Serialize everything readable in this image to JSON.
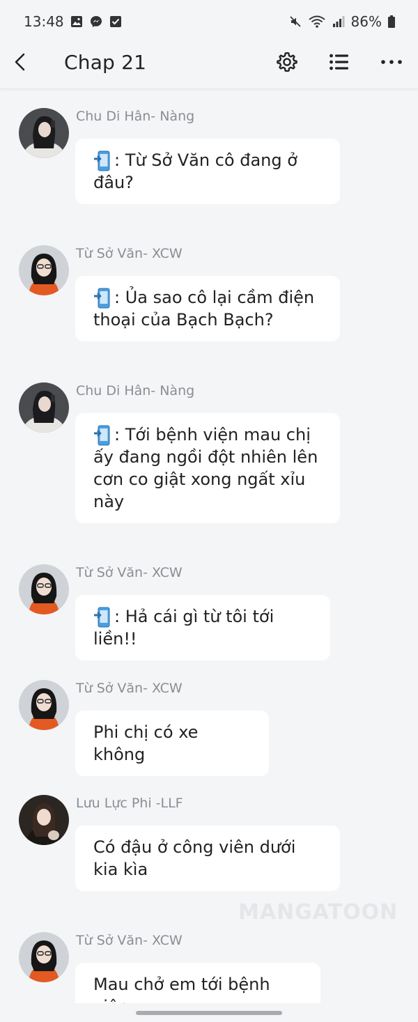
{
  "status_bar": {
    "time": "13:48",
    "battery": "86%",
    "left_icons": [
      "gallery-icon",
      "messenger-icon",
      "checkbox-icon"
    ],
    "right_icons": [
      "mute-icon",
      "wifi-icon",
      "signal-icon",
      "battery-icon"
    ]
  },
  "header": {
    "title": "Chap 21",
    "icons": [
      "back-arrow-icon",
      "gear-icon",
      "list-icon",
      "more-dots-icon"
    ]
  },
  "messages": [
    {
      "sender": "Chu Di Hân- Nàng",
      "text": ": Từ Sở Văn cô đang ở đâu?",
      "has_phone_icon": true,
      "avatar": "avatar-girl-white-top"
    },
    {
      "sender": "Từ Sở Văn- XCW",
      "text": ": Ủa sao cô lại cầm điện thoại của Bạch Bạch?",
      "has_phone_icon": true,
      "avatar": "avatar-girl-glasses"
    },
    {
      "sender": "Chu Di Hân- Nàng",
      "text": ": Tới bệnh viện mau chị ấy đang ngồi đột nhiên lên cơn co giật xong ngất xỉu này",
      "has_phone_icon": true,
      "avatar": "avatar-girl-white-top"
    },
    {
      "sender": "Từ Sở Văn- XCW",
      "text": ": Hả cái gì từ tôi tới liền!!",
      "has_phone_icon": true,
      "avatar": "avatar-girl-glasses"
    },
    {
      "sender": "Từ Sở Văn- XCW",
      "text": "Phi chị có xe không",
      "has_phone_icon": false,
      "avatar": "avatar-girl-glasses"
    },
    {
      "sender": "Lưu Lực Phi -LLF",
      "text": "Có đậu ở công viên dưới kia kìa",
      "has_phone_icon": false,
      "avatar": "avatar-girl-dark"
    },
    {
      "sender": "Từ Sở Văn- XCW",
      "text": "Mau chở em tới bệnh viện",
      "has_phone_icon": false,
      "avatar": "avatar-girl-glasses"
    }
  ],
  "watermark": "MANGATOON",
  "colors": {
    "background": "#f4f5f7",
    "bubble": "#ffffff",
    "sender_text": "#8a8d93",
    "message_text": "#222222",
    "phone_icon": "#3a8fd8"
  }
}
